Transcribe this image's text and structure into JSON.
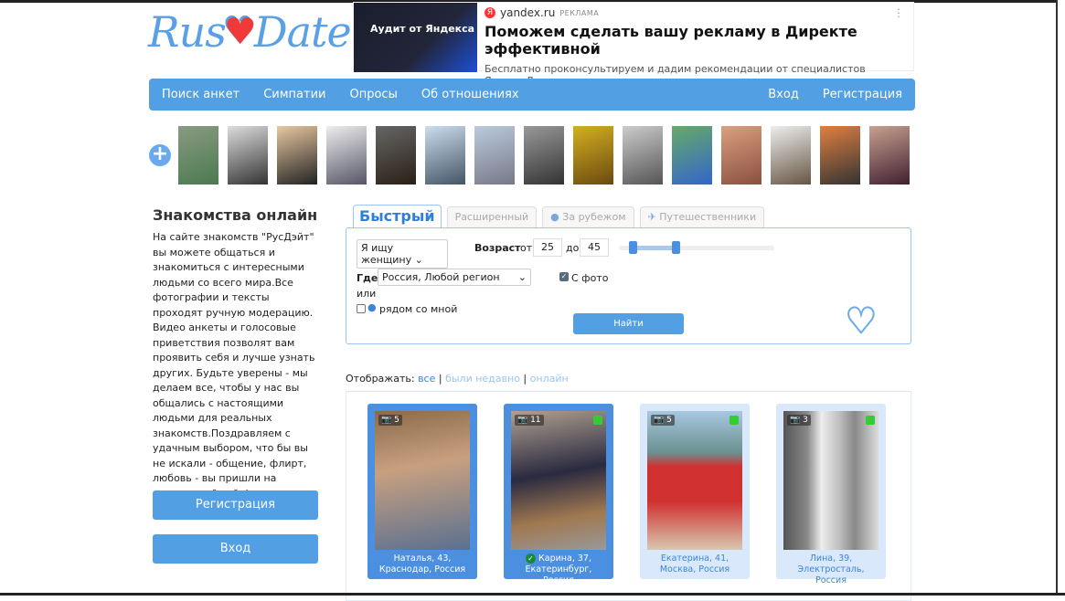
{
  "logo": {
    "text_left": "Rus",
    "text_right": "Date",
    "heart": "♥"
  },
  "ad": {
    "image_text": "Аудит от Яндекса",
    "source": "yandex.ru",
    "tag": "РЕКЛАМА",
    "title": "Поможем сделать вашу рекламу в Директе эффективной",
    "description": "Бесплатно проконсультируем и дадим рекомендации от специалистов Яндекс Директа",
    "menu": "⋮"
  },
  "nav": {
    "items": [
      "Поиск анкет",
      "Симпатии",
      "Опросы",
      "Об отношениях"
    ],
    "login": "Вход",
    "register": "Регистрация"
  },
  "strip": {
    "add": "+",
    "photo_count": 15
  },
  "sidebar": {
    "title": "Знакомства онлайн",
    "text": "На сайте знакомств \"РусДэйт\" вы можете общаться и знакомиться с интересными людьми со всего мира.Все фотографии и тексты проходят ручную модерацию. Видео анкеты и голосовые приветствия позволят вам проявить себя и лучше узнать других. Будьте уверены - мы делаем все, чтобы у нас вы общались с настоящими людьми для реальных знакомств.Поздравляем с удачным выбором, что бы вы не искали - общение, флирт, любовь - вы пришли на правильный сайт!",
    "register": "Регистрация",
    "login": "Вход"
  },
  "tabs": [
    "Быстрый",
    "Расширенный",
    "За рубежом",
    "Путешественники"
  ],
  "search": {
    "seeking": "Я ищу женщину",
    "age_label": "Возраст",
    "from_label": "от",
    "from": "25",
    "to_label": "до",
    "to": "45",
    "age_range": [
      25,
      45
    ],
    "where_label": "Где",
    "location": "Россия, Любой регион",
    "with_photo": "С фото",
    "with_photo_checked": true,
    "or": "или",
    "nearby": "рядом со мной",
    "nearby_checked": false,
    "submit": "Найти"
  },
  "filter": {
    "label": "Отображать:",
    "all": "все",
    "recent": "были недавно",
    "online": "онлайн"
  },
  "profiles": [
    {
      "photos": "5",
      "name": "Наталья, 43,",
      "city": "Краснодар, Россия",
      "online": false,
      "verified": false,
      "highlight": true
    },
    {
      "photos": "11",
      "name": "Карина, 37,",
      "city": "Екатеринбург, Россия",
      "online": true,
      "verified": true,
      "highlight": true
    },
    {
      "photos": "5",
      "name": "Екатерина, 41,",
      "city": "Москва, Россия",
      "online": true,
      "verified": false,
      "highlight": false
    },
    {
      "photos": "3",
      "name": "Лина, 39,",
      "city": "Электросталь, Россия",
      "online": true,
      "verified": false,
      "highlight": false
    }
  ]
}
